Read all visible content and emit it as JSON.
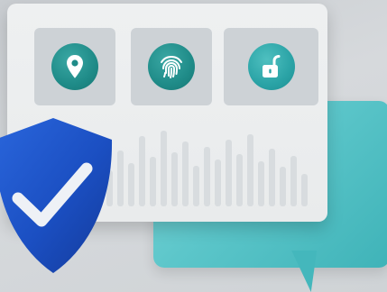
{
  "icons": {
    "location": "location-pin-icon",
    "fingerprint": "fingerprint-icon",
    "unlock": "unlocked-padlock-icon",
    "shield": "shield-check-icon"
  },
  "colors": {
    "background": "#cfd3d6",
    "card": "#eceeef",
    "tile": "#cdd2d6",
    "icon_teal": "#1f8b88",
    "chat_bubble": "#5cc6ca",
    "shield_blue": "#1b4fc2",
    "check_mark": "#eef1f6"
  }
}
